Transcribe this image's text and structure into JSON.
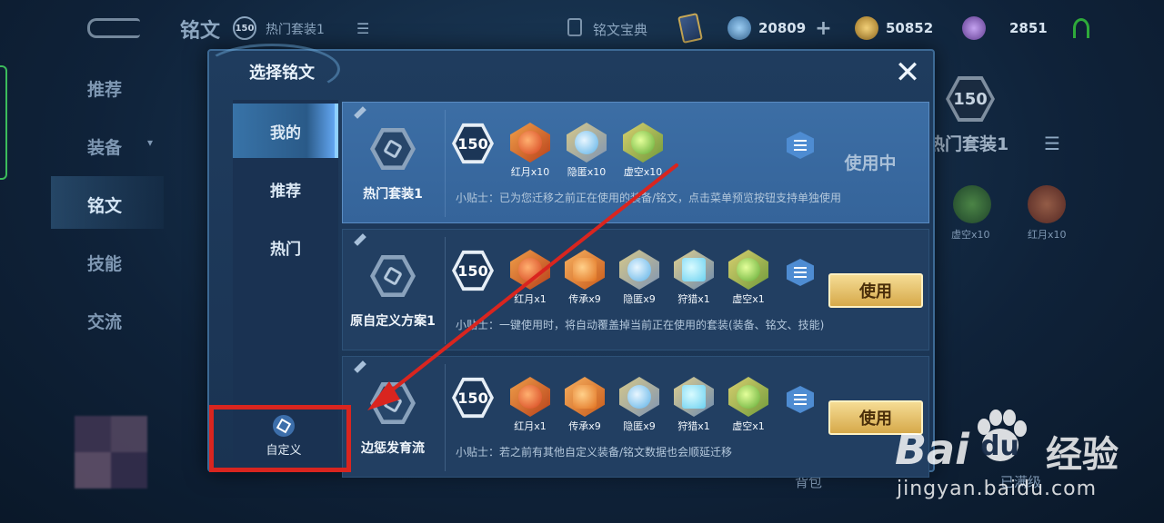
{
  "background": {
    "title": "铭文",
    "level": "150",
    "preset": "热门套装1",
    "codex": "铭文宝典",
    "currencies": [
      {
        "icon": "diamond-icon",
        "value": "20809",
        "color": "#6aa6d8",
        "plus": "+"
      },
      {
        "icon": "gold-coin-icon",
        "value": "50852",
        "color": "#c8a040"
      },
      {
        "icon": "crystal-icon",
        "value": "2851",
        "color": "#9a6ec8"
      }
    ],
    "nav": [
      "推荐",
      "装备",
      "铭文",
      "技能",
      "交流"
    ],
    "nav_active_index": 2,
    "right_level": "150",
    "right_preset": "热门套装1",
    "right_gems": [
      {
        "label": "虚空x10",
        "color": "#5ea832"
      },
      {
        "label": "红月x10",
        "color": "#d4401c"
      }
    ],
    "bottom_tabs": [
      "背包",
      "已满级"
    ]
  },
  "modal": {
    "title": "选择铭文",
    "close_symbol": "✕",
    "tabs": [
      "我的",
      "推荐",
      "热门"
    ],
    "active_tab_index": 0,
    "custom_label": "自定义",
    "status_in_use": "使用中",
    "use_label": "使用",
    "presets": [
      {
        "name": "热门套装1",
        "level": "150",
        "active": true,
        "runes": [
          {
            "label": "红月x10",
            "kind": "red"
          },
          {
            "label": "隐匿x10",
            "kind": "blue"
          },
          {
            "label": "虚空x10",
            "kind": "green"
          }
        ],
        "tip": "小贴士：已为您迁移之前正在使用的装备/铭文，点击菜单预览按钮支持单独使用"
      },
      {
        "name": "原自定义方案1",
        "level": "150",
        "active": false,
        "runes": [
          {
            "label": "红月x1",
            "kind": "red"
          },
          {
            "label": "传承x9",
            "kind": "orange"
          },
          {
            "label": "隐匿x9",
            "kind": "blue"
          },
          {
            "label": "狩猎x1",
            "kind": "cyan"
          },
          {
            "label": "虚空x1",
            "kind": "green"
          }
        ],
        "tip": "小贴士：一键使用时，将自动覆盖掉当前正在使用的套装(装备、铭文、技能)"
      },
      {
        "name": "边惩发育流",
        "level": "150",
        "active": false,
        "runes": [
          {
            "label": "红月x1",
            "kind": "red"
          },
          {
            "label": "传承x9",
            "kind": "orange"
          },
          {
            "label": "隐匿x9",
            "kind": "blue"
          },
          {
            "label": "狩猎x1",
            "kind": "cyan"
          },
          {
            "label": "虚空x1",
            "kind": "green"
          }
        ],
        "tip": "小贴士：若之前有其他自定义装备/铭文数据也会顺延迁移"
      }
    ]
  },
  "annotation": {
    "arrow_color": "#d9251f",
    "box_color": "#d9251f"
  },
  "watermark": {
    "brand": "Bai",
    "brand_du": "du",
    "brand_cn": "经验",
    "url": "jingyan.baidu.com"
  }
}
